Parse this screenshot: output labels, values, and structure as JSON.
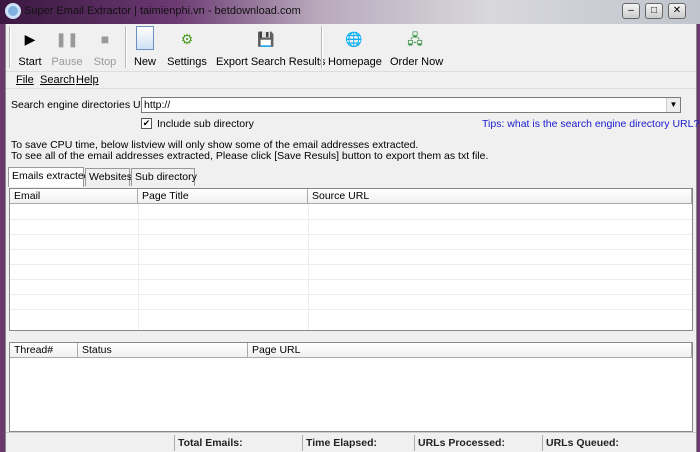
{
  "window": {
    "title": "Super Email Extractor | taimienphi.vn - betdownload.com",
    "minimize": "–",
    "maximize": "□",
    "close": "✕"
  },
  "toolbar": {
    "start": "Start",
    "pause": "Pause",
    "stop": "Stop",
    "new": "New",
    "settings": "Settings",
    "export": "Export Search Results",
    "homepage": "Homepage",
    "order": "Order Now"
  },
  "menu": {
    "file": "File",
    "search": "Search",
    "help": "Help"
  },
  "search": {
    "label": "Search engine directories  URL:",
    "url_value": "http://",
    "include_sub": "Include sub directory",
    "include_checked": true,
    "tips_link": "Tips: what is the search engine directory URL?"
  },
  "info": {
    "line1": "To save CPU time, below listview will only show some of the email addresses extracted.",
    "line2": "To see all of the email addresses extracted, Please click [Save Resuls] button to export them as txt file."
  },
  "tabs": [
    "Emails extracted",
    "Websites",
    "Sub directory"
  ],
  "emails_table": {
    "columns": [
      "Email",
      "Page Title",
      "Source URL"
    ]
  },
  "threads_table": {
    "columns": [
      "Thread#",
      "Status",
      "Page URL"
    ]
  },
  "statusbar": {
    "total_emails": "Total Emails:",
    "time_elapsed": "Time Elapsed:",
    "urls_processed": "URLs Processed:",
    "urls_queued": "URLs Queued:"
  }
}
